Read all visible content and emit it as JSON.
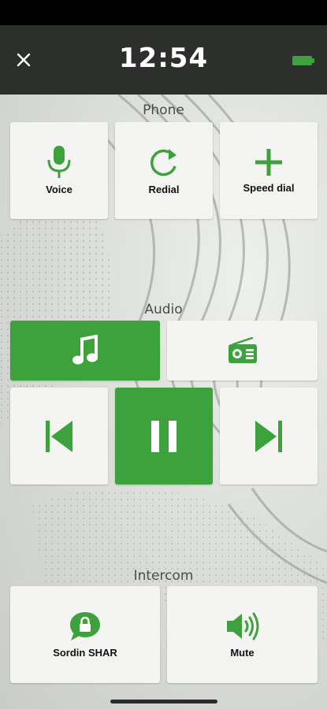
{
  "header": {
    "time": "12:54",
    "close_icon": "close-icon",
    "battery_icon": "battery-icon"
  },
  "colors": {
    "accent": "#3da23b",
    "header_bg": "#2c2f2b",
    "tile_bg": "#f4f4f3"
  },
  "phone": {
    "title": "Phone",
    "buttons": [
      {
        "label": "Voice",
        "icon": "microphone-icon"
      },
      {
        "label": "Redial",
        "icon": "redial-icon"
      },
      {
        "label": "Speed dial",
        "icon": "plus-icon"
      }
    ]
  },
  "audio": {
    "title": "Audio",
    "sources": [
      {
        "icon": "music-note-icon",
        "active": true
      },
      {
        "icon": "radio-icon",
        "active": false
      }
    ],
    "controls": [
      {
        "icon": "previous-track-icon",
        "active": false
      },
      {
        "icon": "pause-icon",
        "active": true
      },
      {
        "icon": "next-track-icon",
        "active": false
      }
    ]
  },
  "intercom": {
    "title": "Intercom",
    "buttons": [
      {
        "label": "Sordin SHAR",
        "icon": "locked-chat-icon"
      },
      {
        "label": "Mute",
        "icon": "speaker-icon"
      }
    ]
  }
}
